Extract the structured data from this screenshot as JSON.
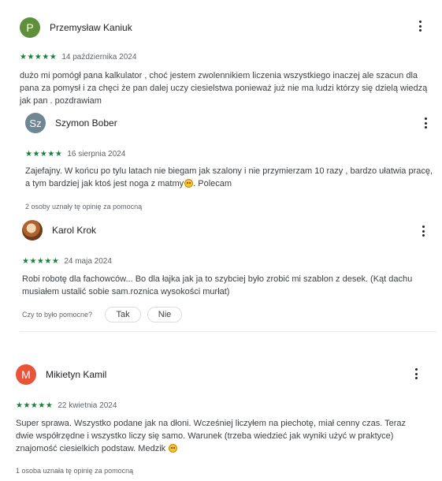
{
  "reviews": [
    {
      "avatar_letter": "P",
      "avatar_color": "#5f8f3a",
      "name": "Przemysław Kaniuk",
      "stars": "★★★★★",
      "date": "14 października 2024",
      "text": "dużo mi pomógł pana kalkulator , choć jestem zwolennikiem liczenia wszystkiego inaczej ale szacun dla pana za pomysł i za chęci że pan dalej uczy ciesielstwa ponieważ już nie ma ludzi którzy się dzielą wiedzą jak pan . pozdrawiam"
    },
    {
      "avatar_letter": "Sz",
      "avatar_color": "#6f8794",
      "name": "Szymon Bober",
      "stars": "★★★★★",
      "date": "16 sierpnia 2024",
      "text": "Zajefajny. W końcu po tylu latach nie biegam jak szalony i nie przymierzam 10 razy , bardzo ułatwia pracę, a tym bardziej jak ktoś jest noga z matmy",
      "text_after_emoji": ". Polecam",
      "helpful": "2 osoby uznały tę opinię za pomocną"
    },
    {
      "avatar_letter": "",
      "name": "Karol Krok",
      "stars": "★★★★★",
      "date": "24 maja 2024",
      "text": "Robi robotę dla fachowców... Bo dla łajka jak ja to szybciej było zrobić mi szablon z desek. (Kąt dachu musiałem ustalić sobie sam.roznica wysokości murłat)",
      "ask": "Czy to było pomocne?",
      "yes_label": "Tak",
      "no_label": "Nie"
    },
    {
      "avatar_letter": "M",
      "avatar_color": "#e8533a",
      "name": "Mikietyn Kamil",
      "stars": "★★★★★",
      "date": "22 kwietnia 2024",
      "text": "Super sprawa. Wszystko podane jak na dłoni. Wcześniej liczyłem na piechotę, miał cenny czas. Teraz dwie współrzędne i wszystko liczy się samo. Warunek (trzeba wiedzieć jak wyniki użyć w praktyce) znajomość ciesielkich podstaw. Medzik",
      "helpful": "1 osoba uznała tę opinię za pomocną"
    }
  ]
}
